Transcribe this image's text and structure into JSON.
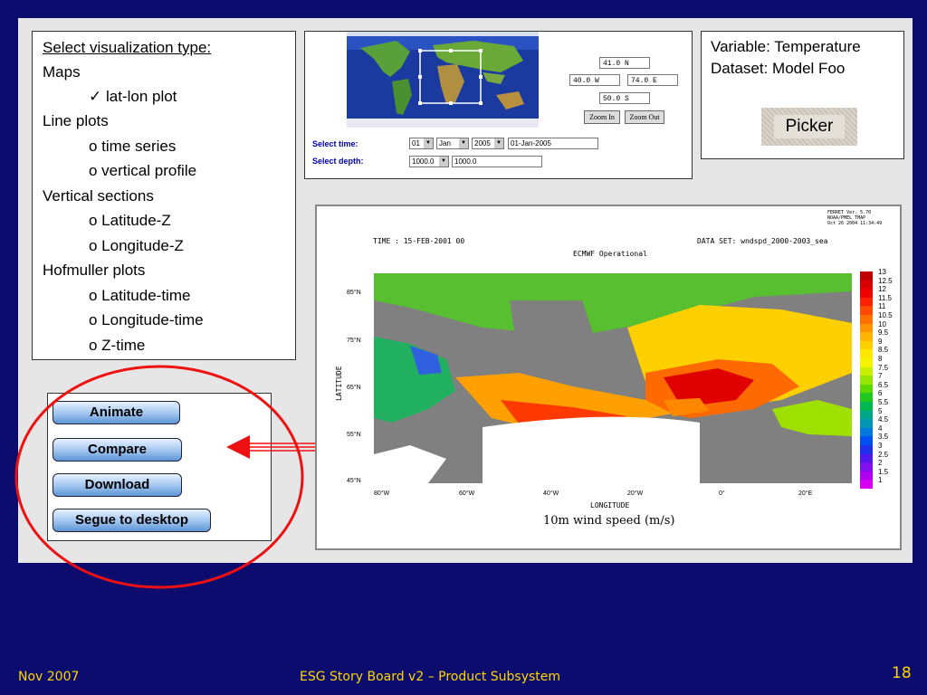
{
  "vis": {
    "title": "Select visualization type:",
    "items": [
      "Maps",
      "✓ lat-lon plot",
      "Line plots",
      "o time series",
      "o vertical profile",
      "Vertical sections",
      "o Latitude-Z",
      "o Longitude-Z",
      "Hofmuller plots",
      "o Latitude-time",
      "o Longitude-time",
      "o Z-time"
    ]
  },
  "mapsel": {
    "north": "41.0 N",
    "west": "40.0 W",
    "east": "74.0 E",
    "south": "50.0 S",
    "zoom_in": "Zoom In",
    "zoom_out": "Zoom Out",
    "time_label": "Select time:",
    "depth_label": "Select depth:",
    "day": "01",
    "month": "Jan",
    "year": "2005",
    "date_text": "01-Jan-2005",
    "depth_select": "1000.0",
    "depth_text": "1000.0"
  },
  "info": {
    "variable": "Variable: Temperature",
    "dataset": "Dataset: Model Foo",
    "picker": "Picker"
  },
  "actions": {
    "animate": "Animate",
    "compare": "Compare",
    "download": "Download",
    "segue": "Segue to desktop"
  },
  "plot": {
    "header": "FERRET Ver. 5.70\nNOAA/PMEL TMAP\nOct 26 2004 11:34:49",
    "time": "TIME : 15-FEB-2001 00",
    "dataset": "DATA SET: wndspd_2000-2003_sea",
    "subtitle": "ECMWF Operational",
    "ylabel": "LATITUDE",
    "xlabel": "LONGITUDE",
    "title": "10m wind speed (m/s)",
    "lat_ticks": [
      "85°N",
      "75°N",
      "65°N",
      "55°N",
      "45°N"
    ],
    "lon_ticks": [
      "80°W",
      "60°W",
      "40°W",
      "20°W",
      "0°",
      "20°E"
    ],
    "scale": [
      "13",
      "12.5",
      "12",
      "11.5",
      "11",
      "10.5",
      "10",
      "9.5",
      "9",
      "8.5",
      "8",
      "7.5",
      "7",
      "6.5",
      "6",
      "5.5",
      "5",
      "4.5",
      "4",
      "3.5",
      "3",
      "2.5",
      "2",
      "1.5",
      "1"
    ],
    "scale_colors": [
      "#c00000",
      "#d80000",
      "#f00000",
      "#ff2000",
      "#ff4a00",
      "#ff7000",
      "#ff9400",
      "#ffb400",
      "#ffd000",
      "#ffe800",
      "#f4f400",
      "#c8f000",
      "#96e600",
      "#5ad800",
      "#20c820",
      "#00b850",
      "#00a888",
      "#0096b4",
      "#0078dc",
      "#0050f0",
      "#2030f0",
      "#5018f0",
      "#8010f0",
      "#b000f0",
      "#d800f0"
    ]
  },
  "footer": {
    "date": "Nov 2007",
    "title": "ESG Story Board v2 – Product Subsystem",
    "page": "18"
  }
}
